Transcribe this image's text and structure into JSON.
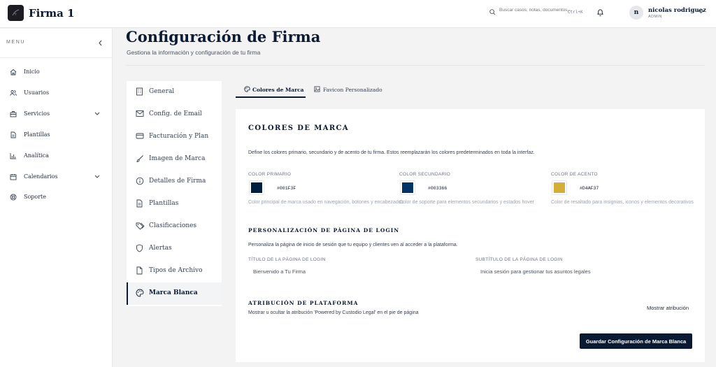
{
  "app": {
    "title": "Firma 1"
  },
  "topbar": {
    "search_placeholder": "Buscar casos, notas, documentos...",
    "search_shortcut": "Ctrl+K",
    "user_name": "nicolas rodriguez",
    "user_role": "ADMIN",
    "avatar_initial": "n"
  },
  "sidebar": {
    "menu_label": "MENU",
    "items": [
      {
        "label": "Inicio",
        "icon": "home-icon"
      },
      {
        "label": "Usuarios",
        "icon": "users-icon"
      },
      {
        "label": "Servicios",
        "icon": "briefcase-icon",
        "expandable": true
      },
      {
        "label": "Plantillas",
        "icon": "file-icon"
      },
      {
        "label": "Analítica",
        "icon": "chart-icon"
      },
      {
        "label": "Calendarios",
        "icon": "calendar-icon",
        "expandable": true
      },
      {
        "label": "Soporte",
        "icon": "lifebuoy-icon"
      }
    ]
  },
  "page": {
    "title": "Configuración de Firma",
    "subtitle": "Gestiona la información y configuración de tu firma"
  },
  "settings_nav": {
    "items": [
      {
        "label": "General",
        "icon": "building-icon"
      },
      {
        "label": "Config. de Email",
        "icon": "mail-icon"
      },
      {
        "label": "Facturación y Plan",
        "icon": "credit-card-icon"
      },
      {
        "label": "Imagen de Marca",
        "icon": "brush-icon"
      },
      {
        "label": "Detalles de Firma",
        "icon": "info-icon"
      },
      {
        "label": "Plantillas",
        "icon": "file-icon"
      },
      {
        "label": "Clasificaciones",
        "icon": "tags-icon"
      },
      {
        "label": "Alertas",
        "icon": "shield-icon"
      },
      {
        "label": "Tipos de Archivo",
        "icon": "file-type-icon"
      },
      {
        "label": "Marca Blanca",
        "icon": "palette-icon",
        "active": true
      }
    ]
  },
  "tabs": [
    {
      "label": "Colores de Marca",
      "icon": "palette-icon",
      "active": true
    },
    {
      "label": "Favicon Personalizado",
      "icon": "image-icon",
      "active": false
    }
  ],
  "brand_colors": {
    "title": "COLORES DE MARCA",
    "description": "Define los colores primario, secundario y de acento de tu firma. Estos reemplazarán los colores predeterminados en toda la interfaz.",
    "colors": [
      {
        "label": "COLOR PRIMARIO",
        "hex": "#001F3F",
        "help": "Color principal de marca usado en navegación, botones y encabezados"
      },
      {
        "label": "COLOR SECUNDARIO",
        "hex": "#003366",
        "help": "Color de soporte para elementos secundarios y estados hover"
      },
      {
        "label": "COLOR DE ACENTO",
        "hex": "#D4AF37",
        "help": "Color de resaltado para insignias, iconos y elementos decorativos"
      }
    ]
  },
  "login": {
    "title": "PERSONALIZACIÓN DE PÁGINA DE LOGIN",
    "description": "Personaliza la página de inicio de sesión que tu equipo y clientes ven al acceder a la plataforma.",
    "page_title_label": "TÍTULO DE LA PÁGINA DE LOGIN",
    "page_title_value": "Bienvenido a Tu Firma",
    "page_subtitle_label": "SUBTÍTULO DE LA PÁGINA DE LOGIN",
    "page_subtitle_value": "Inicia sesión para gestionar tus asuntos legales"
  },
  "attribution": {
    "title": "ATRIBUCIÓN DE PLATAFORMA",
    "description": "Mostrar u ocultar la atribución 'Powered by Custodio Legal' en el pie de página",
    "toggle_label": "Mostrar atribución"
  },
  "actions": {
    "save_label": "Guardar Configuración de Marca Blanca"
  }
}
